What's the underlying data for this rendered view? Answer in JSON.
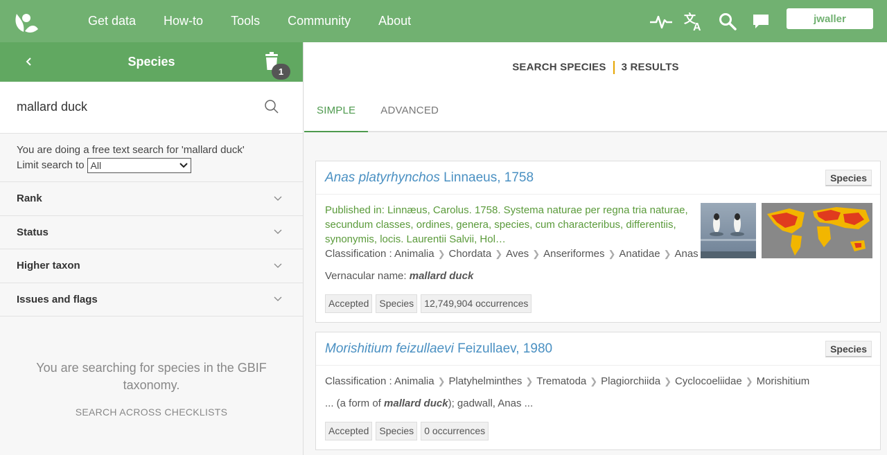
{
  "nav": {
    "items": [
      "Get data",
      "How-to",
      "Tools",
      "Community",
      "About"
    ],
    "icons": [
      "activity-icon",
      "translate-icon",
      "search-icon",
      "feedback-icon"
    ],
    "user": "jwaller"
  },
  "left": {
    "title": "Species",
    "basket_count": "1",
    "search_value": "mallard duck",
    "free_text": "You are doing a free text search for 'mallard duck'",
    "limit_label": "Limit search to",
    "limit_value": "All",
    "facets": [
      "Rank",
      "Status",
      "Higher taxon",
      "Issues and flags"
    ],
    "footer_msg": "You are searching for species in the GBIF taxonomy.",
    "footer_link": "SEARCH ACROSS CHECKLISTS"
  },
  "right": {
    "summary_label": "SEARCH SPECIES",
    "summary_count": "3 RESULTS",
    "tabs": [
      "SIMPLE",
      "ADVANCED"
    ]
  },
  "results": [
    {
      "name_italic": "Anas platyrhynchos",
      "author": "Linnaeus, 1758",
      "type": "Species",
      "published": "Published in: Linnæus, Carolus. 1758. Systema naturae per regna tria naturae, secundum classes, ordines, genera, species, cum characteribus, differentiis, synonymis, locis. Laurentii Salvii, Hol…",
      "classification_label": "Classification :",
      "classification": [
        "Animalia",
        "Chordata",
        "Aves",
        "Anseriformes",
        "Anatidae",
        "Anas"
      ],
      "vernacular_label": "Vernacular name:",
      "vernacular": "mallard duck",
      "tags": [
        "Accepted",
        "Species",
        "12,749,904 occurrences"
      ]
    },
    {
      "name_italic": "Morishitium feizullaevi",
      "author": "Feizullaev, 1980",
      "type": "Species",
      "classification_label": "Classification :",
      "classification": [
        "Animalia",
        "Platyhelminthes",
        "Trematoda",
        "Plagiorchiida",
        "Cyclocoeliidae",
        "Morishitium"
      ],
      "snippet_pre": "... (a form of ",
      "snippet_bold": "mallard duck",
      "snippet_post": "); gadwall, Anas ...",
      "tags": [
        "Accepted",
        "Species",
        "0 occurrences"
      ]
    }
  ],
  "colors": {
    "nav_green": "#71b171",
    "panel_green": "#61a861",
    "link_blue": "#4a90c2",
    "accent_orange": "#e6a500"
  }
}
